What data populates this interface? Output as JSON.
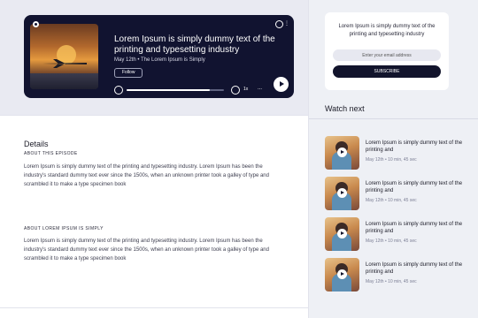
{
  "player": {
    "title": "Lorem Ipsum is simply dummy text of the printing and typesetting industry",
    "meta": "May 12th • The Lorem Ipsum is Simply",
    "follow_label": "Follow",
    "speed_label": "1x",
    "more_label": "...",
    "progress": 0.85
  },
  "details": {
    "title": "Details",
    "about_episode_heading": "ABOUT THIS EPISODE",
    "about_episode_text": "Lorem Ipsum is simply dummy text of the printing and typesetting industry. Lorem Ipsum has been the industry's standard dummy text ever since the 1500s, when an unknown printer took a galley of type and scrambled it to make a type specimen book",
    "about_show_heading": "ABOUT LOREM IPSUM IS SIMPLY",
    "about_show_text": "Lorem Ipsum is simply dummy text of the printing and typesetting industry. Lorem Ipsum has been the industry's standard dummy text ever since the 1500s, when an unknown printer took a galley of type and scrambled it to make a type specimen book"
  },
  "subscribe": {
    "text": "Lorem Ipsum is simply dummy text of the printing and typesetting industry",
    "email_placeholder": "Enter your email address",
    "button_label": "SUBSCRIBE"
  },
  "watch_next": {
    "title": "Watch next",
    "items": [
      {
        "title": "Lorem Ipsum is simply dummy text of the printing and",
        "meta": "May 12th • 10 min, 45 sec"
      },
      {
        "title": "Lorem Ipsum is simply dummy text of the printing and",
        "meta": "May 12th • 10 min, 45 sec"
      },
      {
        "title": "Lorem Ipsum is simply dummy text of the printing and",
        "meta": "May 12th • 10 min, 45 sec"
      },
      {
        "title": "Lorem Ipsum is simply dummy text of the printing and",
        "meta": "May 12th • 10 min, 45 sec"
      }
    ]
  }
}
